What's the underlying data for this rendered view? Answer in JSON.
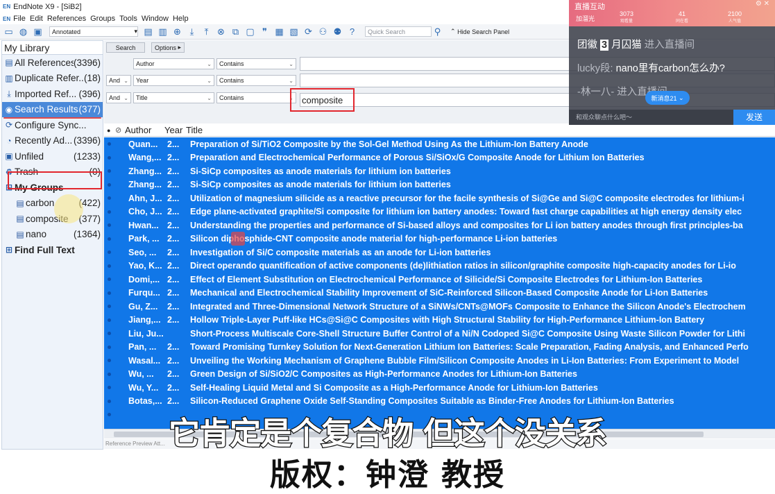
{
  "window": {
    "title": "EndNote X9 - [SiB2]",
    "app_icon": "EN"
  },
  "menu": [
    "File",
    "Edit",
    "References",
    "Groups",
    "Tools",
    "Window",
    "Help"
  ],
  "toolbar": {
    "style_select": "Annotated",
    "quick_search_placeholder": "Quick Search",
    "hide_search_panel": "Hide Search Panel"
  },
  "sidebar": {
    "library_title": "My Library",
    "items": [
      {
        "label": "All References",
        "count": "(3396)",
        "icon": "all-references-icon",
        "glyph": "▤"
      },
      {
        "label": "Duplicate Refer...",
        "count": "(18)",
        "icon": "duplicate-icon",
        "glyph": "▥"
      },
      {
        "label": "Imported Ref...",
        "count": "(396)",
        "icon": "import-icon",
        "glyph": "⤓"
      },
      {
        "label": "Search Results",
        "count": "(377)",
        "icon": "search-icon",
        "glyph": "◉"
      },
      {
        "label": "Configure Sync...",
        "count": "",
        "icon": "sync-icon",
        "glyph": "⟳"
      },
      {
        "label": "Recently Ad...",
        "count": "(3396)",
        "icon": "clock-icon",
        "glyph": "◔"
      },
      {
        "label": "Unfiled",
        "count": "(1233)",
        "icon": "unfiled-icon",
        "glyph": "▣"
      },
      {
        "label": "Trash",
        "count": "(0)",
        "icon": "trash-icon",
        "glyph": "♻"
      }
    ],
    "my_groups_label": "My Groups",
    "groups": [
      {
        "label": "carbon",
        "count": "(422)"
      },
      {
        "label": "composite",
        "count": "(377)"
      },
      {
        "label": "nano",
        "count": "(1364)"
      }
    ],
    "find_full_text_label": "Find Full Text"
  },
  "search_panel": {
    "search_button": "Search",
    "options_button": "Options",
    "rows": [
      {
        "bool": "",
        "field": "Author",
        "operator": "Contains",
        "value": ""
      },
      {
        "bool": "And",
        "field": "Year",
        "operator": "Contains",
        "value": ""
      },
      {
        "bool": "And",
        "field": "Title",
        "operator": "Contains",
        "value": "composite"
      }
    ]
  },
  "list": {
    "columns": {
      "author": "Author",
      "year": "Year",
      "title": "Title"
    },
    "rows": [
      {
        "author": "Quan...",
        "year": "2...",
        "title": "Preparation of Si/TiO2 Composite by the Sol-Gel Method Using As the Lithium-Ion Battery Anode"
      },
      {
        "author": "Wang,...",
        "year": "2...",
        "title": "Preparation and Electrochemical Performance of Porous Si/SiOx/G Composite Anode for Lithium Ion Batteries"
      },
      {
        "author": "Zhang...",
        "year": "2...",
        "title": "Si-SiCp composites as anode materials for lithium ion batteries"
      },
      {
        "author": "Zhang...",
        "year": "2...",
        "title": "Si-SiCp composites as anode materials for lithium ion batteries"
      },
      {
        "author": "Ahn, J...",
        "year": "2...",
        "title": "Utilization of magnesium silicide as a reactive precursor for the facile synthesis of Si@Ge and Si@C composite electrodes for lithium-i"
      },
      {
        "author": "Cho, J...",
        "year": "2...",
        "title": "Edge plane-activated graphite/Si composite for lithium ion battery anodes: Toward fast charge capabilities at high energy density elec"
      },
      {
        "author": "Hwan...",
        "year": "2...",
        "title": "Understanding the properties and performance of Si-based alloys and composites for Li ion battery anodes through first principles-ba"
      },
      {
        "author": "Park, ...",
        "year": "2...",
        "title": "Silicon diphosphide-CNT composite anode material for high-performance Li-ion batteries"
      },
      {
        "author": "Seo, ...",
        "year": "2...",
        "title": "Investigation of Si/C composite materials as an anode for Li-ion batteries"
      },
      {
        "author": "Yao, K...",
        "year": "2...",
        "title": "Direct operando quantification of active components (de)lithiation ratios in silicon/graphite composite high-capacity anodes for Li-io"
      },
      {
        "author": "Domi,...",
        "year": "2...",
        "title": "Effect of Element Substitution on Electrochemical Performance of Silicide/Si Composite Electrodes for Lithium-Ion Batteries"
      },
      {
        "author": "Furqu...",
        "year": "2...",
        "title": "Mechanical and Electrochemical Stability Improvement of SiC-Reinforced Silicon-Based Composite Anode for Li-Ion Batteries"
      },
      {
        "author": "Gu, Z...",
        "year": "2...",
        "title": "Integrated and Three-Dimensional Network Structure of a SiNWs/CNTs@MOFs Composite to Enhance the Silicon Anode's Electrochem"
      },
      {
        "author": "Jiang,...",
        "year": "2...",
        "title": "Hollow Triple-Layer Puff-like HCs@Si@C Composites with High Structural Stability for High-Performance Lithium-Ion Battery"
      },
      {
        "author": "Liu, Ju...",
        "year": "",
        "title": "Short-Process Multiscale Core-Shell Structure Buffer Control of a Ni/N Codoped Si@C Composite Using Waste Silicon Powder for Lithi"
      },
      {
        "author": "Pan, ...",
        "year": "2...",
        "title": "Toward Promising Turnkey Solution for Next-Generation Lithium Ion Batteries: Scale Preparation, Fading Analysis, and Enhanced Perfo"
      },
      {
        "author": "Wasal...",
        "year": "2...",
        "title": "Unveiling the Working Mechanism of Graphene Bubble Film/Silicon Composite Anodes in Li-Ion Batteries: From Experiment to Model"
      },
      {
        "author": "Wu, ...",
        "year": "2...",
        "title": "Green Design of Si/SiO2/C Composites as High-Performance Anodes for Lithium-Ion Batteries"
      },
      {
        "author": "Wu, Y...",
        "year": "2...",
        "title": "Self-Healing Liquid Metal and Si Composite as a High-Performance Anode for Lithium-Ion Batteries"
      },
      {
        "author": "Botas,...",
        "year": "2...",
        "title": "Silicon-Reduced Graphene Oxide Self-Standing Composites Suitable as Binder-Free Anodes for Lithium-Ion Batteries"
      },
      {
        "author": "",
        "year": "",
        "title": ""
      },
      {
        "author": "",
        "year": "",
        "title": ""
      }
    ]
  },
  "bottom_tabs": "Reference   Preview   Att...",
  "live_panel": {
    "title": "直播互动",
    "label": "加溜光",
    "stats": [
      {
        "value": "3073",
        "label": "观看量"
      },
      {
        "value": "41",
        "label": "同在看"
      },
      {
        "value": "2100",
        "label": "人气值"
      }
    ],
    "messages": [
      {
        "tag": "团徽",
        "level": "3",
        "name": "月囚猫",
        "text": "进入直播间"
      },
      {
        "name": "lucky段:",
        "text": "nano里有carbon怎么办?"
      },
      {
        "name": "-林一八-",
        "text": "进入直播间"
      }
    ],
    "new_messages": "新消息21",
    "input_placeholder": "和观众聊点什么吧～",
    "send_button": "发送"
  },
  "subtitles": {
    "line1": "它肯定是个复合物 但这个没关系",
    "line2": "版权：钟澄 教授"
  },
  "colors": {
    "selection": "#1177e8",
    "highlight_box": "#e2262d",
    "active_sidebar": "#4a89d9"
  }
}
